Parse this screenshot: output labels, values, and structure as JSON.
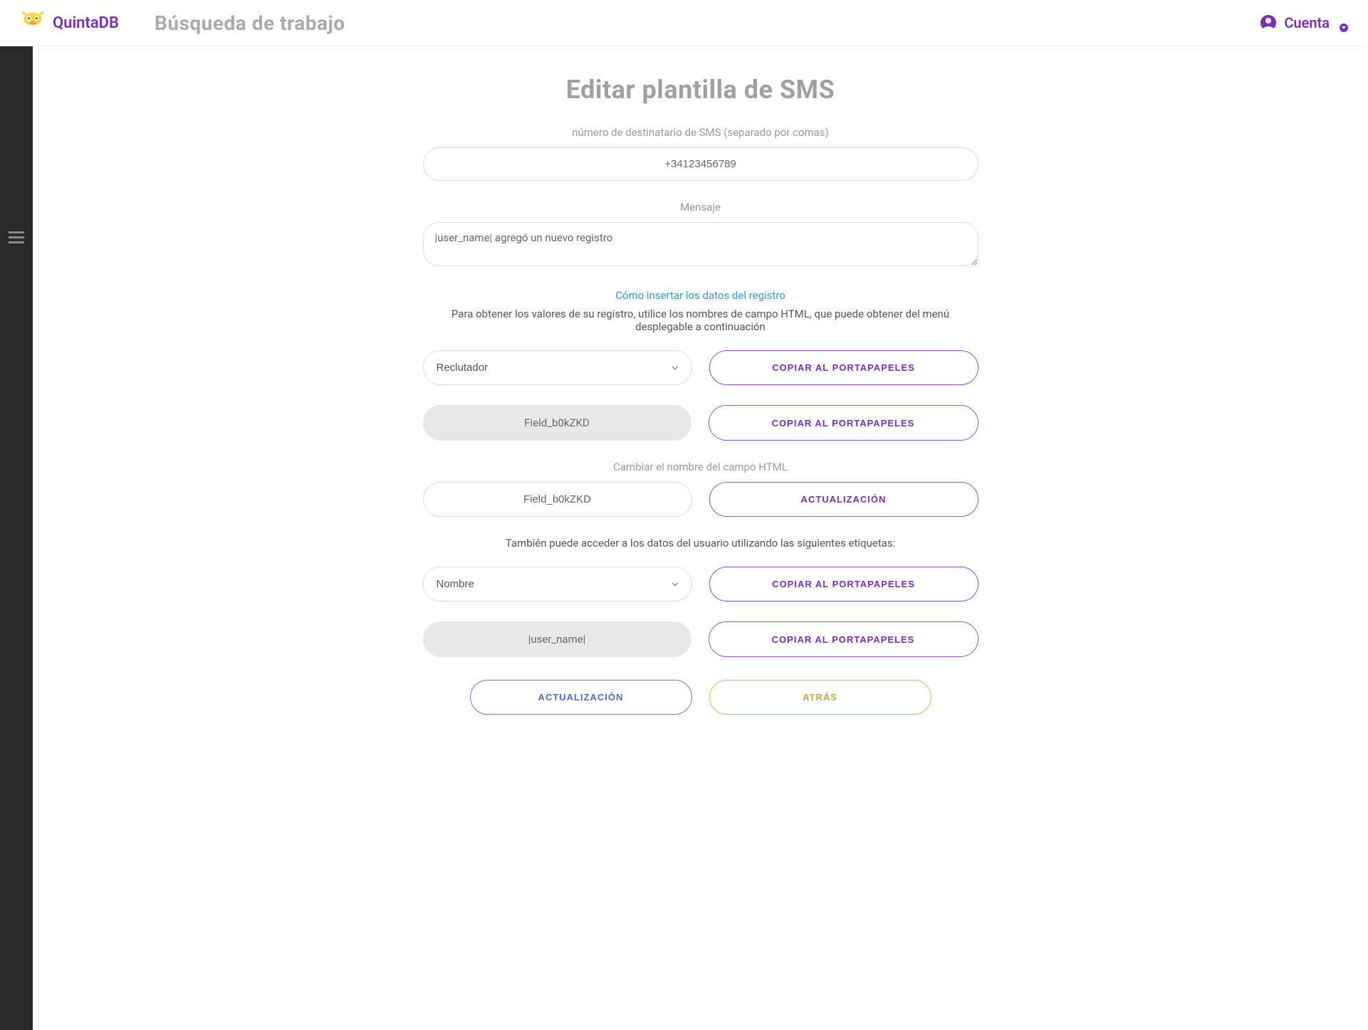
{
  "header": {
    "brand": "QuintaDB",
    "title": "Búsqueda de trabajo",
    "account": "Cuenta"
  },
  "main": {
    "title": "Editar plantilla de SMS",
    "recipient_label": "número de destinatario de SMS (separado por comas)",
    "recipient_value": "+34123456789",
    "message_label": "Mensaje",
    "message_value": "|user_name| agregó un nuevo registro",
    "insert_link": "Cómo insertar los datos del registro",
    "insert_help": "Para obtener los valores de su registro, utilice los nombres de campo HTML, que puede obtener del menú desplegable a continuación",
    "field_select_value": "Reclutador",
    "copy_button": "COPIAR AL PORTAPAPELES",
    "field_code": "Field_b0kZKD",
    "rename_label": "Cambiar el nombre del campo HTML",
    "rename_value": "Field_b0kZKD",
    "update_button": "ACTUALIZACIÓN",
    "user_tags_help": "También puede acceder a los datos del usuario utilizando las siguientes etiquetas:",
    "user_select_value": "Nombre",
    "user_tag_code": "|user_name|",
    "submit_button": "ACTUALIZACIÓN",
    "back_button": "ATRÁS"
  }
}
